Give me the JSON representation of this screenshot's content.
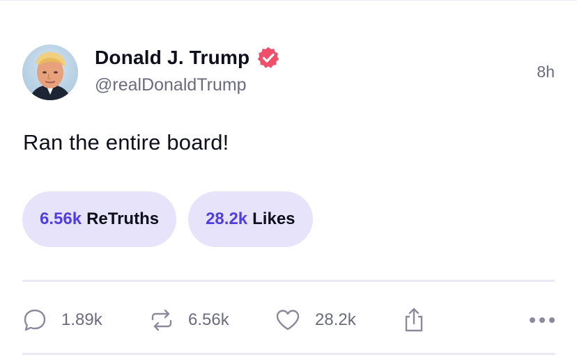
{
  "post": {
    "author": {
      "display_name": "Donald J. Trump",
      "handle": "@realDonaldTrump",
      "verified": true,
      "verified_badge_color": "#ef4f6a"
    },
    "timestamp": "8h",
    "text": "Ran the entire board!",
    "summary_pills": [
      {
        "count": "6.56k",
        "label": "ReTruths"
      },
      {
        "count": "28.2k",
        "label": "Likes"
      }
    ],
    "actions": {
      "replies": "1.89k",
      "retruths": "6.56k",
      "likes": "28.2k"
    }
  },
  "colors": {
    "accent": "#4f3fe0",
    "pill_bg": "#e6e3fb",
    "muted_text": "#6b6b80",
    "divider": "#ebe9f8"
  },
  "icons": [
    "verified-badge-icon",
    "reply-icon",
    "retruth-icon",
    "heart-icon",
    "share-icon",
    "more-icon"
  ]
}
